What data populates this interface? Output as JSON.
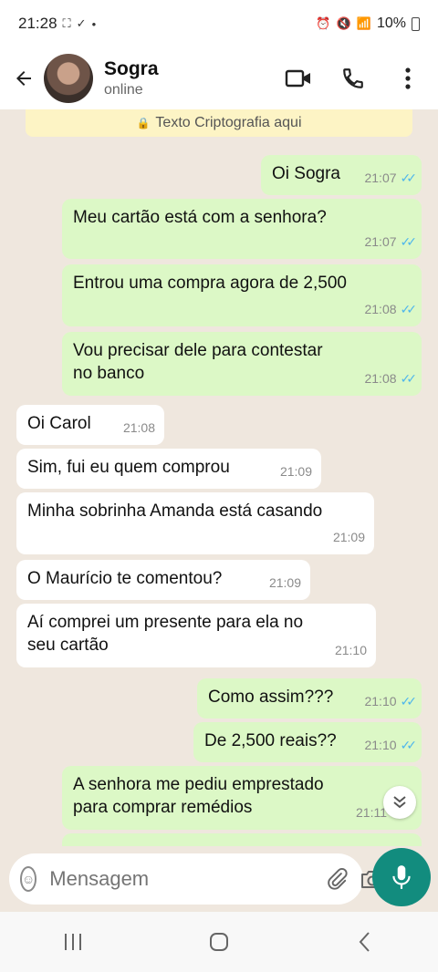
{
  "status": {
    "time": "21:28",
    "battery": "10%"
  },
  "header": {
    "name": "Sogra",
    "status": "online"
  },
  "encryption_notice": "Texto Criptografia aqui",
  "messages": [
    {
      "text": "Oi Sogra",
      "time": "21:07"
    },
    {
      "text": "Meu cartão está com a senhora?",
      "time": "21:07"
    },
    {
      "text": "Entrou uma compra agora de 2,500",
      "time": "21:08"
    },
    {
      "text": "Vou precisar dele para contestar no banco",
      "time": "21:08"
    },
    {
      "text": "Oi Carol",
      "time": "21:08"
    },
    {
      "text": "Sim, fui eu quem comprou",
      "time": "21:09"
    },
    {
      "text": "Minha sobrinha Amanda está casando",
      "time": "21:09"
    },
    {
      "text": "O Maurício te comentou?",
      "time": "21:09"
    },
    {
      "text": "Aí comprei um presente para ela no seu cartão",
      "time": "21:10"
    },
    {
      "text": "Como assim???",
      "time": "21:10"
    },
    {
      "text": "De 2,500 reais??",
      "time": "21:10"
    },
    {
      "text": "A senhora me pediu emprestado para comprar remédios",
      "time": "21:11"
    }
  ],
  "input": {
    "placeholder": "Mensagem"
  },
  "colors": {
    "outgoing": "#dcf8c6",
    "incoming": "#ffffff",
    "accent": "#128c7e",
    "ticks": "#4fb6ec"
  }
}
